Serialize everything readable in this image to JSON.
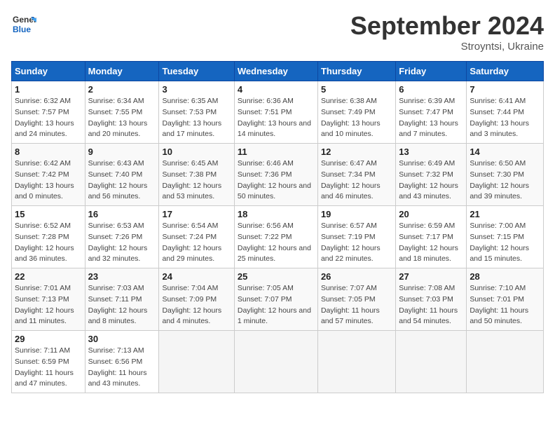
{
  "header": {
    "logo_general": "General",
    "logo_blue": "Blue",
    "title": "September 2024",
    "subtitle": "Stroyntsi, Ukraine"
  },
  "weekdays": [
    "Sunday",
    "Monday",
    "Tuesday",
    "Wednesday",
    "Thursday",
    "Friday",
    "Saturday"
  ],
  "weeks": [
    [
      {
        "day": "1",
        "sunrise": "6:32 AM",
        "sunset": "7:57 PM",
        "daylight": "13 hours and 24 minutes."
      },
      {
        "day": "2",
        "sunrise": "6:34 AM",
        "sunset": "7:55 PM",
        "daylight": "13 hours and 20 minutes."
      },
      {
        "day": "3",
        "sunrise": "6:35 AM",
        "sunset": "7:53 PM",
        "daylight": "13 hours and 17 minutes."
      },
      {
        "day": "4",
        "sunrise": "6:36 AM",
        "sunset": "7:51 PM",
        "daylight": "13 hours and 14 minutes."
      },
      {
        "day": "5",
        "sunrise": "6:38 AM",
        "sunset": "7:49 PM",
        "daylight": "13 hours and 10 minutes."
      },
      {
        "day": "6",
        "sunrise": "6:39 AM",
        "sunset": "7:47 PM",
        "daylight": "13 hours and 7 minutes."
      },
      {
        "day": "7",
        "sunrise": "6:41 AM",
        "sunset": "7:44 PM",
        "daylight": "13 hours and 3 minutes."
      }
    ],
    [
      {
        "day": "8",
        "sunrise": "6:42 AM",
        "sunset": "7:42 PM",
        "daylight": "13 hours and 0 minutes."
      },
      {
        "day": "9",
        "sunrise": "6:43 AM",
        "sunset": "7:40 PM",
        "daylight": "12 hours and 56 minutes."
      },
      {
        "day": "10",
        "sunrise": "6:45 AM",
        "sunset": "7:38 PM",
        "daylight": "12 hours and 53 minutes."
      },
      {
        "day": "11",
        "sunrise": "6:46 AM",
        "sunset": "7:36 PM",
        "daylight": "12 hours and 50 minutes."
      },
      {
        "day": "12",
        "sunrise": "6:47 AM",
        "sunset": "7:34 PM",
        "daylight": "12 hours and 46 minutes."
      },
      {
        "day": "13",
        "sunrise": "6:49 AM",
        "sunset": "7:32 PM",
        "daylight": "12 hours and 43 minutes."
      },
      {
        "day": "14",
        "sunrise": "6:50 AM",
        "sunset": "7:30 PM",
        "daylight": "12 hours and 39 minutes."
      }
    ],
    [
      {
        "day": "15",
        "sunrise": "6:52 AM",
        "sunset": "7:28 PM",
        "daylight": "12 hours and 36 minutes."
      },
      {
        "day": "16",
        "sunrise": "6:53 AM",
        "sunset": "7:26 PM",
        "daylight": "12 hours and 32 minutes."
      },
      {
        "day": "17",
        "sunrise": "6:54 AM",
        "sunset": "7:24 PM",
        "daylight": "12 hours and 29 minutes."
      },
      {
        "day": "18",
        "sunrise": "6:56 AM",
        "sunset": "7:22 PM",
        "daylight": "12 hours and 25 minutes."
      },
      {
        "day": "19",
        "sunrise": "6:57 AM",
        "sunset": "7:19 PM",
        "daylight": "12 hours and 22 minutes."
      },
      {
        "day": "20",
        "sunrise": "6:59 AM",
        "sunset": "7:17 PM",
        "daylight": "12 hours and 18 minutes."
      },
      {
        "day": "21",
        "sunrise": "7:00 AM",
        "sunset": "7:15 PM",
        "daylight": "12 hours and 15 minutes."
      }
    ],
    [
      {
        "day": "22",
        "sunrise": "7:01 AM",
        "sunset": "7:13 PM",
        "daylight": "12 hours and 11 minutes."
      },
      {
        "day": "23",
        "sunrise": "7:03 AM",
        "sunset": "7:11 PM",
        "daylight": "12 hours and 8 minutes."
      },
      {
        "day": "24",
        "sunrise": "7:04 AM",
        "sunset": "7:09 PM",
        "daylight": "12 hours and 4 minutes."
      },
      {
        "day": "25",
        "sunrise": "7:05 AM",
        "sunset": "7:07 PM",
        "daylight": "12 hours and 1 minute."
      },
      {
        "day": "26",
        "sunrise": "7:07 AM",
        "sunset": "7:05 PM",
        "daylight": "11 hours and 57 minutes."
      },
      {
        "day": "27",
        "sunrise": "7:08 AM",
        "sunset": "7:03 PM",
        "daylight": "11 hours and 54 minutes."
      },
      {
        "day": "28",
        "sunrise": "7:10 AM",
        "sunset": "7:01 PM",
        "daylight": "11 hours and 50 minutes."
      }
    ],
    [
      {
        "day": "29",
        "sunrise": "7:11 AM",
        "sunset": "6:59 PM",
        "daylight": "11 hours and 47 minutes."
      },
      {
        "day": "30",
        "sunrise": "7:13 AM",
        "sunset": "6:56 PM",
        "daylight": "11 hours and 43 minutes."
      },
      null,
      null,
      null,
      null,
      null
    ]
  ]
}
